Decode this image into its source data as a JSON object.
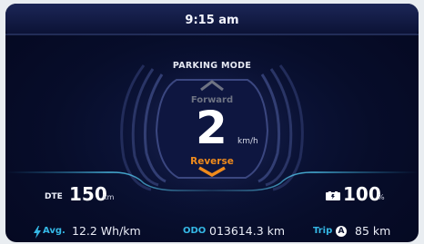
{
  "header": {
    "time": "9:15 am"
  },
  "drive": {
    "mode_title": "PARKING MODE",
    "forward_label": "Forward",
    "speed": "2",
    "speed_unit": "km/h",
    "reverse_label": "Reverse"
  },
  "dte": {
    "label": "DTE",
    "value": "150",
    "unit": "km"
  },
  "battery": {
    "value": "100",
    "unit": "%",
    "level": 1.0
  },
  "stats": {
    "avg_label": "Avg.",
    "avg_value": "12.2 Wh/km",
    "odo_label": "ODO",
    "odo_value": "013614.3 km",
    "trip_label": "Trip",
    "trip_badge": "A",
    "trip_value": "85 km"
  },
  "colors": {
    "accent": "#35b8e6",
    "reverse": "#f08b1c",
    "background": "#070d2a"
  },
  "icons": [
    "lightning-icon",
    "battery-icon",
    "chevron-up-icon",
    "chevron-down-icon"
  ]
}
